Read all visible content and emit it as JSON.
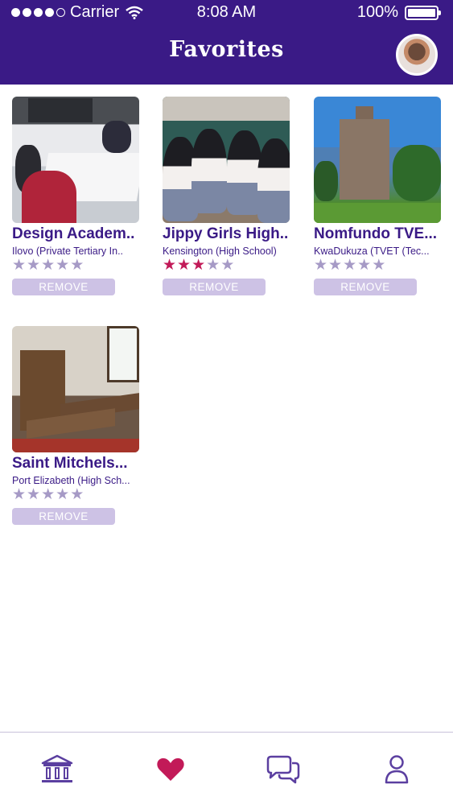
{
  "status_bar": {
    "carrier": "Carrier",
    "time": "8:08 AM",
    "battery": "100%"
  },
  "header": {
    "title": "Favorites"
  },
  "favorites": [
    {
      "name": "Design Academ..",
      "subtitle": "Ilovo (Private Tertiary In..",
      "rating": 0,
      "max_rating": 5,
      "remove_label": "REMOVE"
    },
    {
      "name": "Jippy Girls High..",
      "subtitle": "Kensington (High School)",
      "rating": 3,
      "max_rating": 5,
      "remove_label": "REMOVE"
    },
    {
      "name": "Nomfundo TVE...",
      "subtitle": "KwaDukuza (TVET (Tec...",
      "rating": 0,
      "max_rating": 5,
      "remove_label": "REMOVE"
    },
    {
      "name": "Saint Mitchels...",
      "subtitle": "Port Elizabeth (High Sch...",
      "rating": 0,
      "max_rating": 5,
      "remove_label": "REMOVE"
    }
  ],
  "tabbar": {
    "items": [
      {
        "icon": "institution-icon",
        "active": false
      },
      {
        "icon": "heart-icon",
        "active": true
      },
      {
        "icon": "chat-icon",
        "active": false
      },
      {
        "icon": "profile-icon",
        "active": false
      }
    ]
  },
  "colors": {
    "brand": "#3a1a86",
    "star_filled": "#c21a58",
    "star_empty": "#a69ac6",
    "remove_button": "#cdc2e5"
  }
}
